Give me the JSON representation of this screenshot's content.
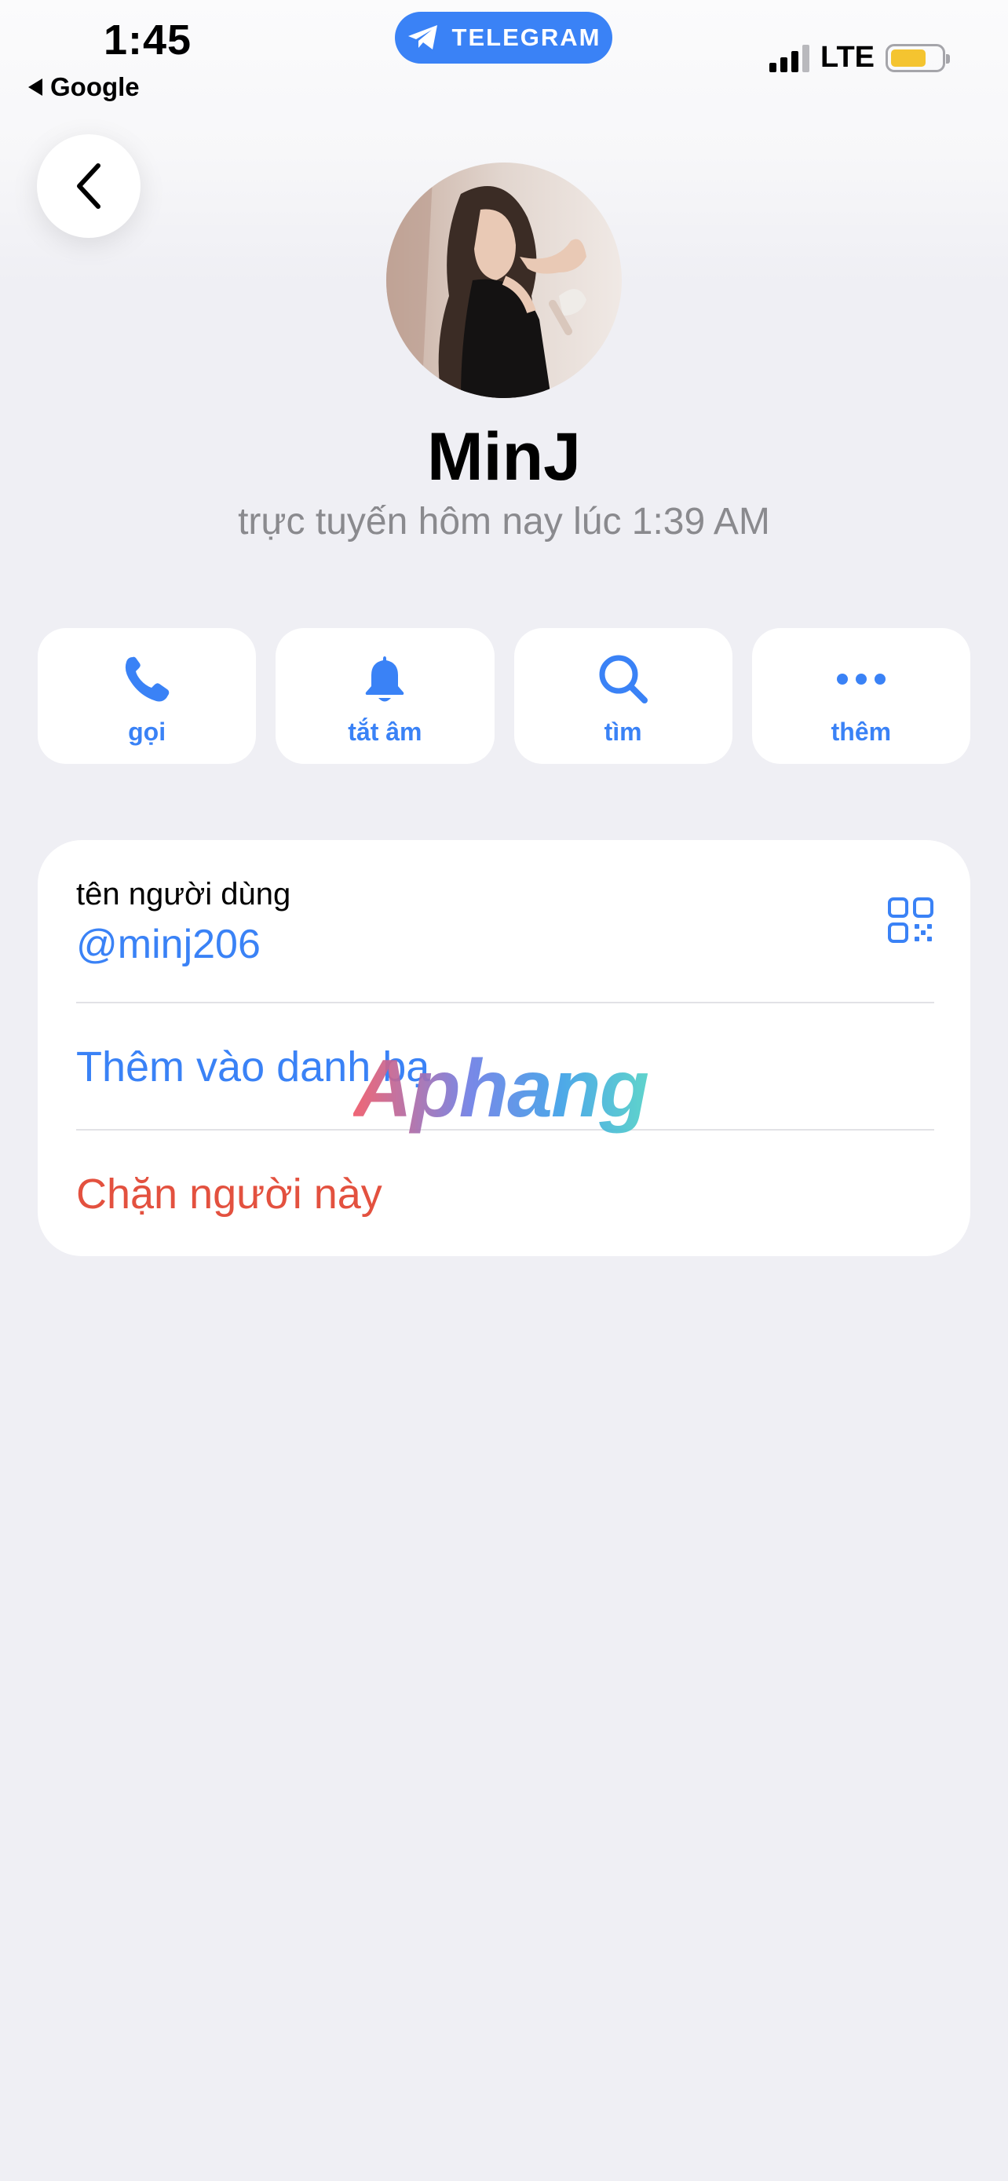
{
  "status_bar": {
    "time": "1:45",
    "back_app": "Google",
    "pill_label": "TELEGRAM",
    "network": "LTE",
    "signal_bars_active": 3,
    "signal_bars_total": 4,
    "battery_level": 0.6
  },
  "profile": {
    "name": "MinJ",
    "last_seen": "trực tuyến hôm nay lúc 1:39 AM"
  },
  "actions": [
    {
      "label": "gọi",
      "icon": "phone-icon"
    },
    {
      "label": "tắt âm",
      "icon": "bell-icon"
    },
    {
      "label": "tìm",
      "icon": "search-icon"
    },
    {
      "label": "thêm",
      "icon": "more-icon"
    }
  ],
  "info": {
    "username_caption": "tên người dùng",
    "username": "@minj206",
    "add_contact": "Thêm vào danh bạ",
    "block_user": "Chặn người này"
  },
  "watermark": "Aphang",
  "colors": {
    "accent": "#3a82f6",
    "danger": "#e3513f",
    "background": "#efeff4",
    "battery": "#f4c430"
  }
}
